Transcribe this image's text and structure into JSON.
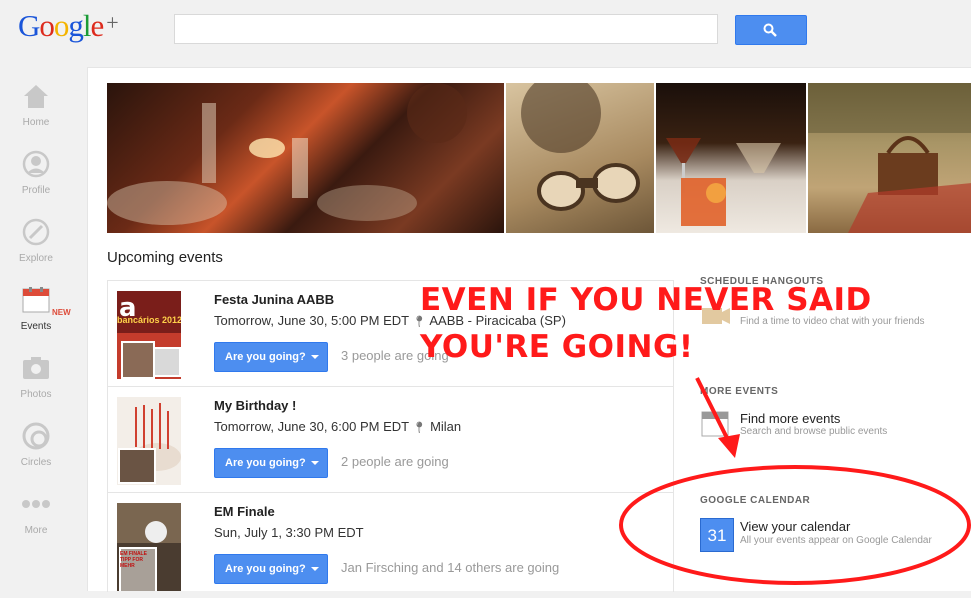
{
  "app": {
    "logo_letters": [
      "G",
      "o",
      "o",
      "g",
      "l",
      "e",
      "+"
    ],
    "logo_colors": [
      "#1a55d9",
      "#dd2b1d",
      "#f4b400",
      "#1a55d9",
      "#1b9b36",
      "#dd2b1d",
      "#666666"
    ]
  },
  "search": {
    "placeholder": "",
    "value": "",
    "button_icon": "search-icon"
  },
  "sidebar": {
    "items": [
      {
        "label": "Home",
        "icon": "home-icon"
      },
      {
        "label": "Profile",
        "icon": "profile-icon"
      },
      {
        "label": "Explore",
        "icon": "explore-icon"
      },
      {
        "label": "Events",
        "icon": "calendar-icon",
        "badge": "NEW"
      },
      {
        "label": "Photos",
        "icon": "camera-icon"
      },
      {
        "label": "Circles",
        "icon": "circles-icon"
      },
      {
        "label": "More",
        "icon": "more-icon"
      }
    ]
  },
  "main": {
    "section_title": "Upcoming events",
    "events": [
      {
        "title": "Festa Junina AABB",
        "when": "Tomorrow, June 30, 5:00 PM EDT",
        "location": "AABB - Piracicaba (SP)",
        "rsvp_label": "Are you going?",
        "going": "3 people are going",
        "thumb_text": "bancários 2012"
      },
      {
        "title": "My Birthday !",
        "when": "Tomorrow, June 30, 6:00 PM EDT",
        "location": "Milan",
        "rsvp_label": "Are you going?",
        "going": "2 people are going"
      },
      {
        "title": "EM Finale",
        "when": "Sun, July 1, 3:30 PM EDT",
        "location": "",
        "rsvp_label": "Are you going?",
        "going": "Jan Firsching and 14 others are going",
        "thumb_text": "EM FINALE TIPP FOR MEHR"
      }
    ]
  },
  "right_panel": {
    "schedule_heading": "SCHEDULE HANGOUTS",
    "schedule_sub": "Find a time to video chat with your friends",
    "more_heading": "MORE EVENTS",
    "more_link": "Find more events",
    "more_sub": "Search and browse public events",
    "calendar_heading": "GOOGLE CALENDAR",
    "calendar_link": "View your calendar",
    "calendar_sub": "All your events appear on Google Calendar",
    "calendar_day": "31"
  },
  "annotation": {
    "line1": "EVEN IF YOU NEVER SAID",
    "line2": "YOU'RE GOING!",
    "color": "#ff1a1a"
  }
}
